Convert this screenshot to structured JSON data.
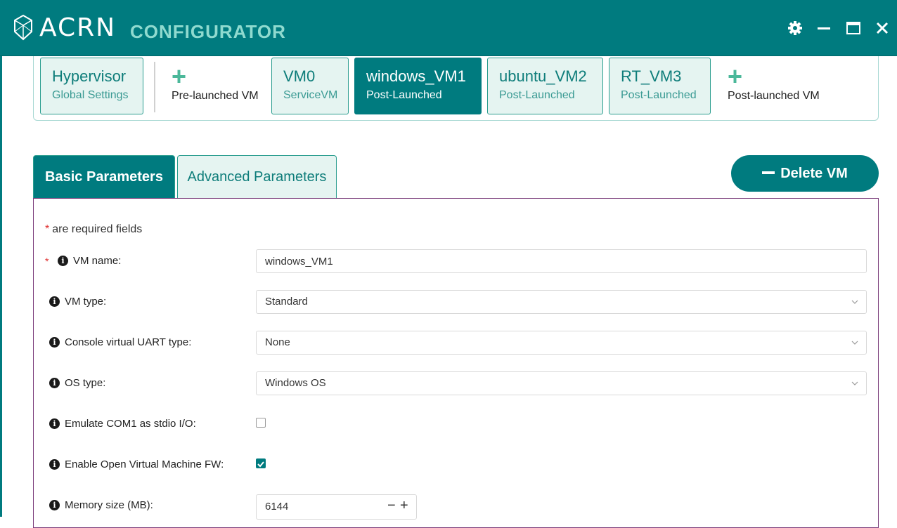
{
  "app": {
    "brand": "ACRN",
    "brand_sub": "CONFIGURATOR",
    "logo_icon": "acrn-logo-icon",
    "window_controls": [
      "settings-icon",
      "minimize-icon",
      "maximize-icon",
      "close-icon"
    ]
  },
  "colors": {
    "primary": "#007b7f",
    "card_bg": "#e5f4f1",
    "accent_plus": "#4bb89a",
    "required_star": "#e03030",
    "panel_border": "#7a3b7a"
  },
  "vm_strip": {
    "hypervisor": {
      "title": "Hypervisor",
      "subtitle": "Global Settings"
    },
    "add_pre": {
      "label": "Pre-launched VM"
    },
    "vms": [
      {
        "title": "VM0",
        "subtitle": "ServiceVM",
        "active": false
      },
      {
        "title": "windows_VM1",
        "subtitle": "Post-Launched",
        "active": true
      },
      {
        "title": "ubuntu_VM2",
        "subtitle": "Post-Launched",
        "active": false
      },
      {
        "title": "RT_VM3",
        "subtitle": "Post-Launched",
        "active": false
      }
    ],
    "add_post": {
      "label": "Post-launched VM"
    }
  },
  "tabs": {
    "basic": "Basic Parameters",
    "advanced": "Advanced Parameters",
    "active": "basic"
  },
  "delete_button": "Delete VM",
  "form": {
    "required_note": "are required fields",
    "vm_name": {
      "label": "VM name:",
      "value": "windows_VM1",
      "required": true
    },
    "vm_type": {
      "label": "VM type:",
      "value": "Standard"
    },
    "console_uart": {
      "label": "Console virtual UART type:",
      "value": "None"
    },
    "os_type": {
      "label": "OS type:",
      "value": "Windows OS"
    },
    "emulate_com1": {
      "label": "Emulate COM1 as stdio I/O:",
      "checked": false
    },
    "ovmf": {
      "label": "Enable Open Virtual Machine FW:",
      "checked": true
    },
    "memory": {
      "label": "Memory size (MB):",
      "value": "6144"
    }
  }
}
